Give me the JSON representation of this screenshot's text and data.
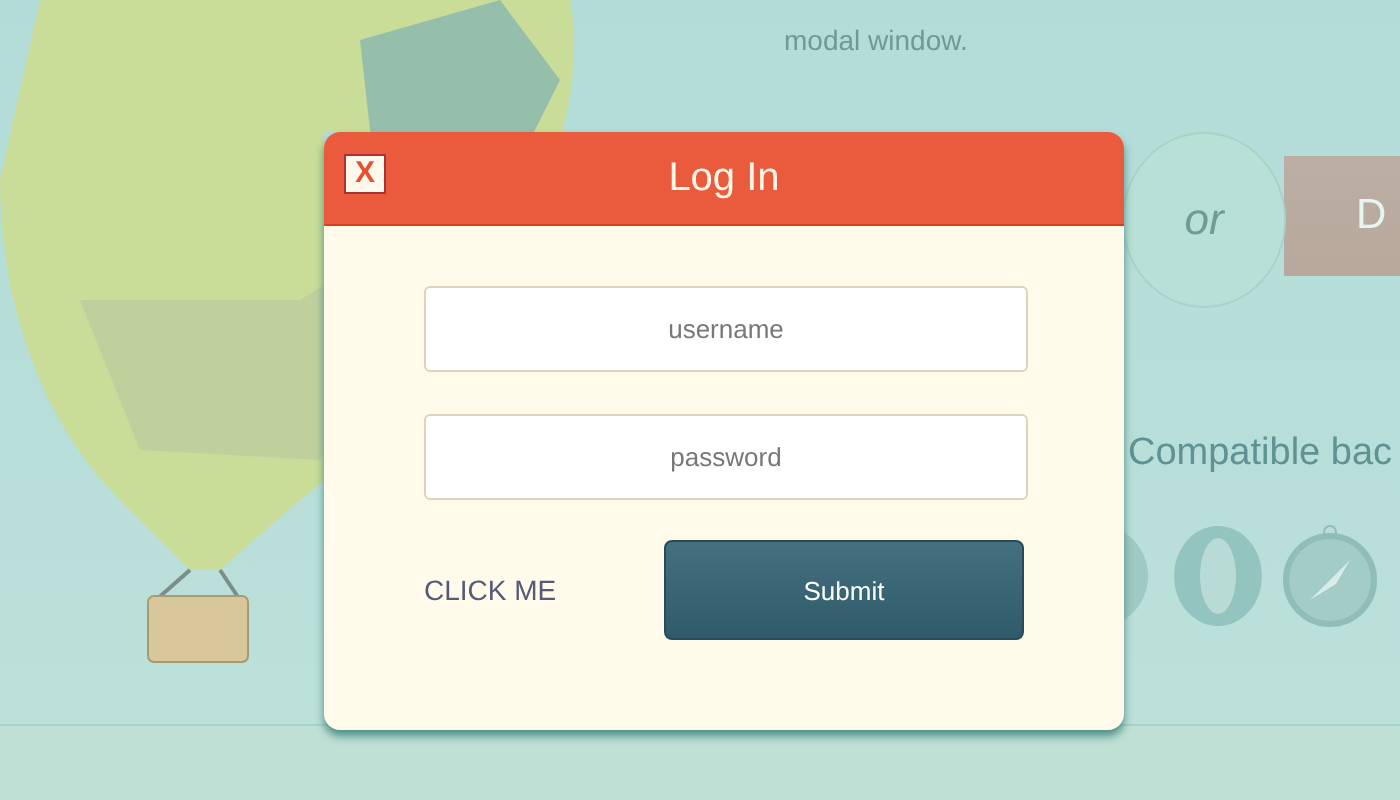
{
  "background": {
    "intro_text_end": "modal window.",
    "or_label": "or",
    "button_label": "D",
    "compat_heading": "Compatible bac"
  },
  "modal": {
    "title": "Log In",
    "close_label": "X",
    "fields": [
      {
        "placeholder": "username"
      },
      {
        "placeholder": "password"
      }
    ],
    "link": "CLICK ME",
    "submit": "Submit"
  }
}
